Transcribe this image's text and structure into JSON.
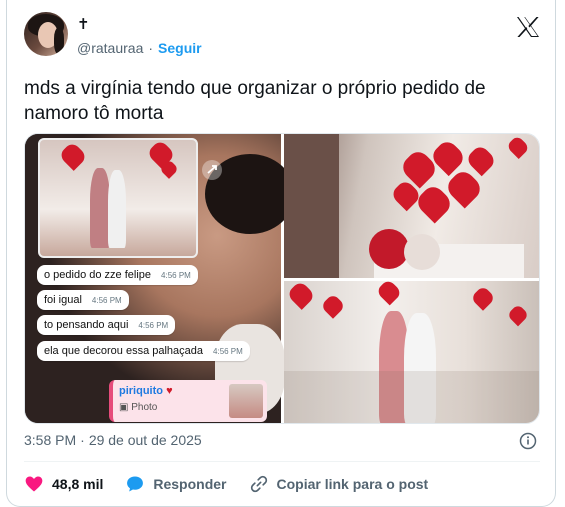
{
  "author": {
    "name": "✝",
    "handle": "@rataurаa",
    "separator": "·",
    "follow_label": "Seguir"
  },
  "tweet": {
    "text": "mds a virgínia tendo que organizar o próprio pedido de namoro tô morta"
  },
  "chat": {
    "messages": [
      {
        "text": "o pedido do zze felipe",
        "time": "4:56 PM"
      },
      {
        "text": "foi igual",
        "time": "4:56 PM"
      },
      {
        "text": "to pensando aqui",
        "time": "4:56 PM"
      },
      {
        "text": "ela que decorou essa palhaçada",
        "time": "4:56 PM"
      }
    ],
    "reply": {
      "who": "piriquito",
      "kind": "Photo"
    }
  },
  "meta": {
    "time": "3:58 PM",
    "sep": "·",
    "date": "29 de out de 2025"
  },
  "actions": {
    "likes": "48,8 mil",
    "reply_label": "Responder",
    "copy_label": "Copiar link para o post"
  },
  "colors": {
    "like": "#f91880",
    "reply": "#1d9bf0",
    "follow": "#1d9bf0",
    "balloon": "#d11a2a"
  },
  "icons": [
    "x-logo-icon",
    "info-icon",
    "heart-icon",
    "chat-bubble-icon",
    "link-icon",
    "camera-icon"
  ]
}
